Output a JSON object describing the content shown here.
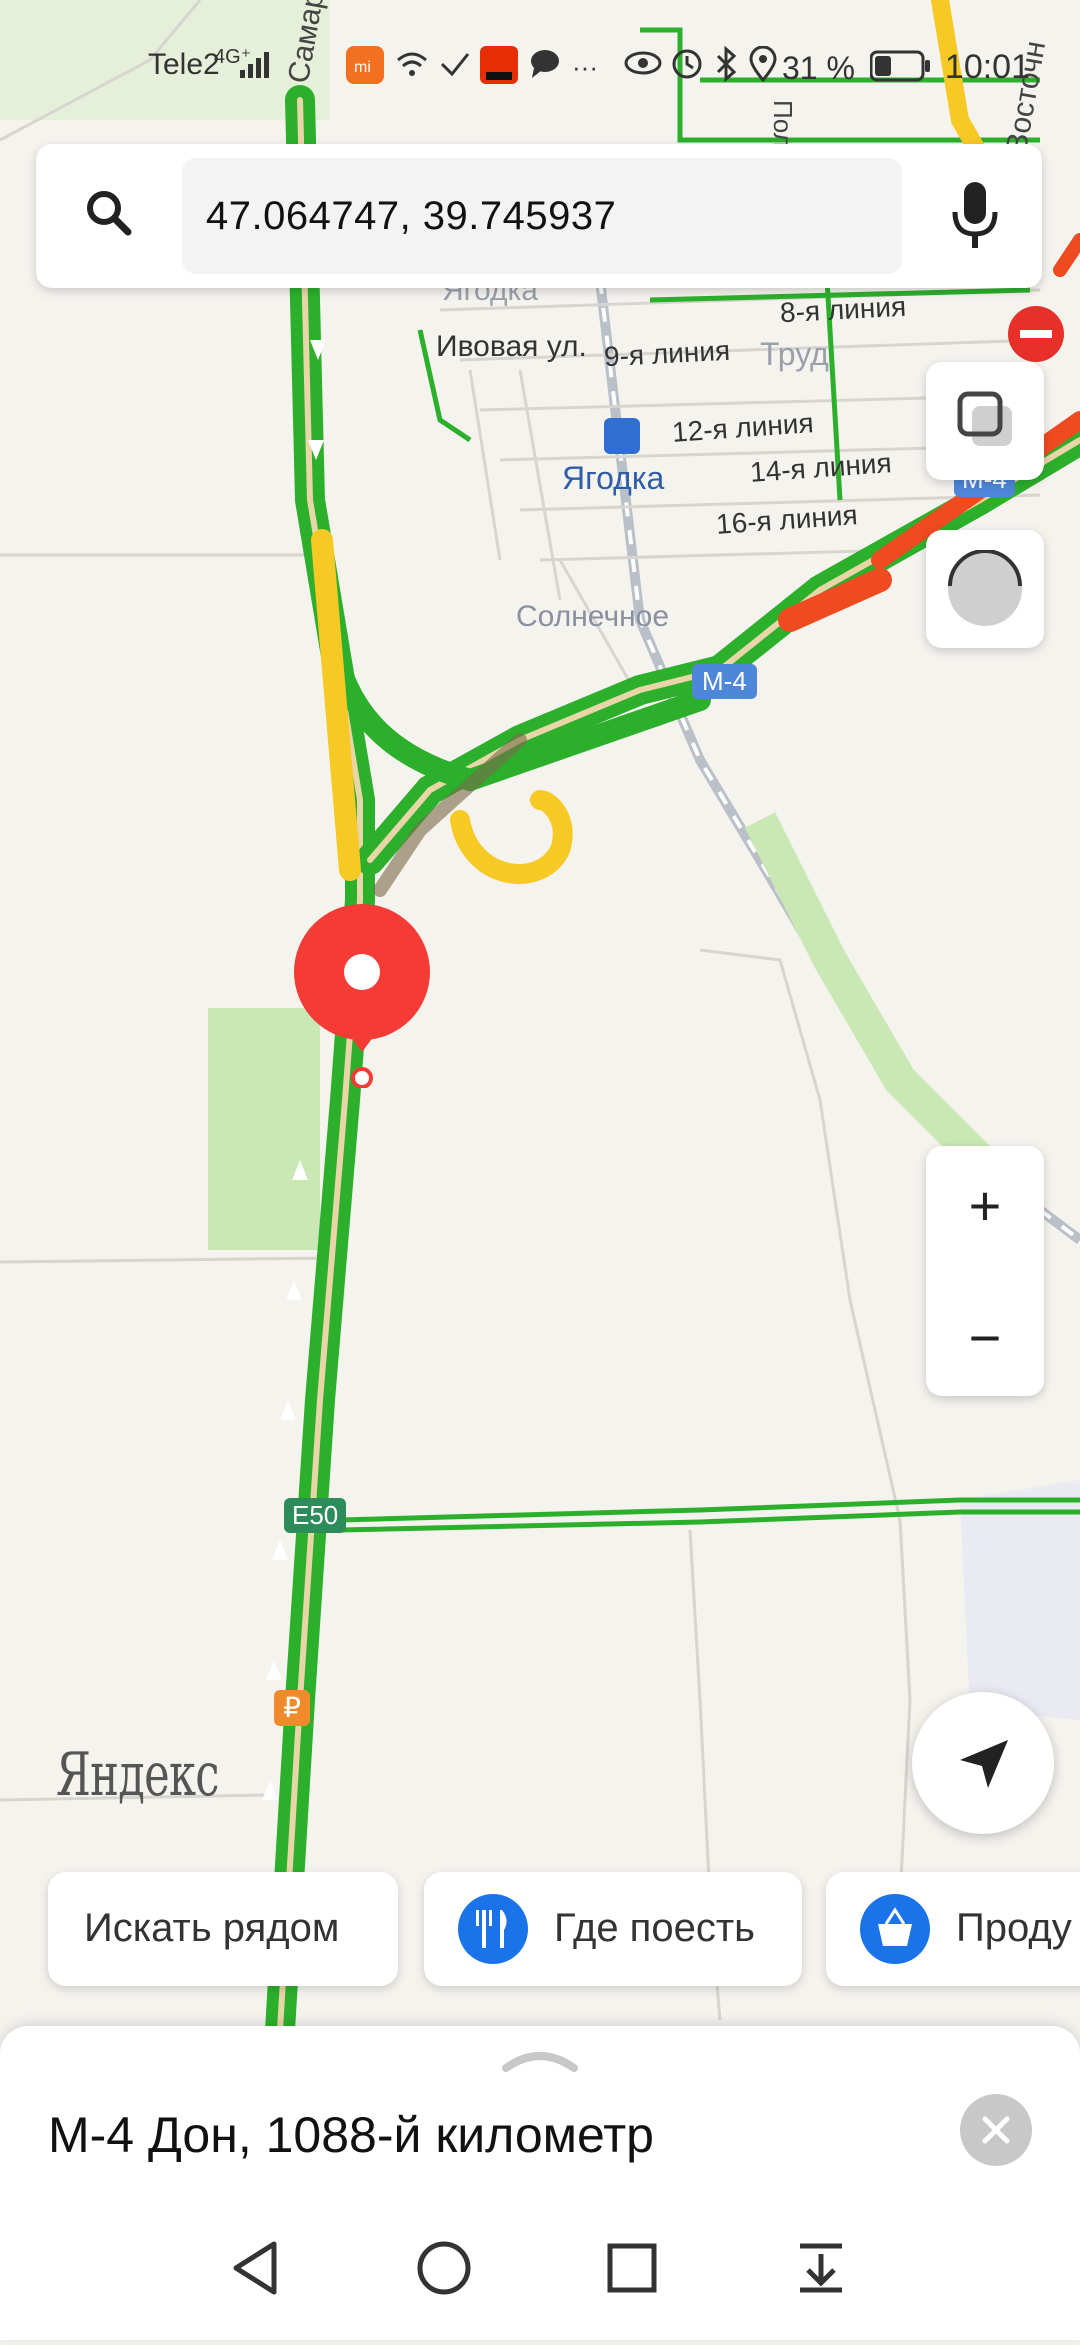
{
  "status_bar": {
    "carrier": "Tele2",
    "network": "4G⁺",
    "battery_percent": "31 %",
    "time": "10:01",
    "icons": [
      "mi-icon",
      "wifi-icon",
      "nfc-icon",
      "aliexpress-icon",
      "chat-icon",
      "more-icon",
      "eye-icon",
      "alarm-icon",
      "bluetooth-icon",
      "location-icon",
      "battery-icon"
    ]
  },
  "search": {
    "query": "47.064747, 39.745937",
    "search_icon": "search-icon",
    "voice_icon": "microphone-icon"
  },
  "map_labels": {
    "yagodka_top": "Ягодка",
    "ivovaya": "Ивовая ул.",
    "line8": "8-я линия",
    "line9": "9-я линия",
    "trud": "Труд",
    "line12": "12-я линия",
    "line14": "14-я линия",
    "line16": "16-я линия",
    "yagodka_station": "Ягодка",
    "solnechnoe": "Солнечное",
    "samarsk": "Самарск",
    "vostochn": "Восточн",
    "polev": "Поле",
    "m4_badge": "М-4",
    "m4_badge_right": "М-4",
    "e50_badge": "E50",
    "ruble": "₽"
  },
  "map_controls": {
    "layers_icon": "layers-icon",
    "traffic_icon": "traffic-light-icon",
    "zoom_in": "+",
    "zoom_out": "−",
    "locate_icon": "navigation-arrow-icon"
  },
  "brand": "Яндекс",
  "chips": [
    {
      "label": "Искать рядом",
      "icon": ""
    },
    {
      "label": "Где поесть",
      "icon": "fork-knife-icon"
    },
    {
      "label": "Проду",
      "icon": "basket-icon"
    }
  ],
  "sheet": {
    "title": "М-4 Дон, 1088-й километр",
    "close_icon": "close-icon",
    "handle_icon": "chevron-up-icon"
  },
  "nav_bar": {
    "back_icon": "back-triangle-icon",
    "home_icon": "home-circle-icon",
    "recent_icon": "recents-square-icon",
    "notif_icon": "notification-pulldown-icon"
  },
  "colors": {
    "traffic_green": "#2cb02c",
    "traffic_yellow": "#f6c925",
    "traffic_red": "#f04a21",
    "pin_red": "#f43b36",
    "accent_blue": "#1a73e8",
    "road_badge_blue": "#4e86d9",
    "road_badge_green": "#2c8c5a"
  }
}
